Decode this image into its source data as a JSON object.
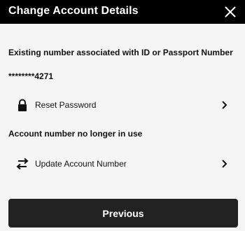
{
  "header": {
    "title": "Change Account Details",
    "close_icon": "close-icon"
  },
  "existing_number": {
    "label": "Existing number associated with ID or Passport Number",
    "value": "********4271"
  },
  "reset_password": {
    "label": "Reset Password",
    "icon": "lock-icon"
  },
  "account_number": {
    "label": "Account number no longer in use"
  },
  "update_account": {
    "label": "Update Account Number",
    "icon": "swap-arrows-icon"
  },
  "footer": {
    "previous_label": "Previous"
  },
  "colors": {
    "header_bg": "#000000",
    "page_bg": "#f5f5f5",
    "button_bg": "#222222"
  }
}
